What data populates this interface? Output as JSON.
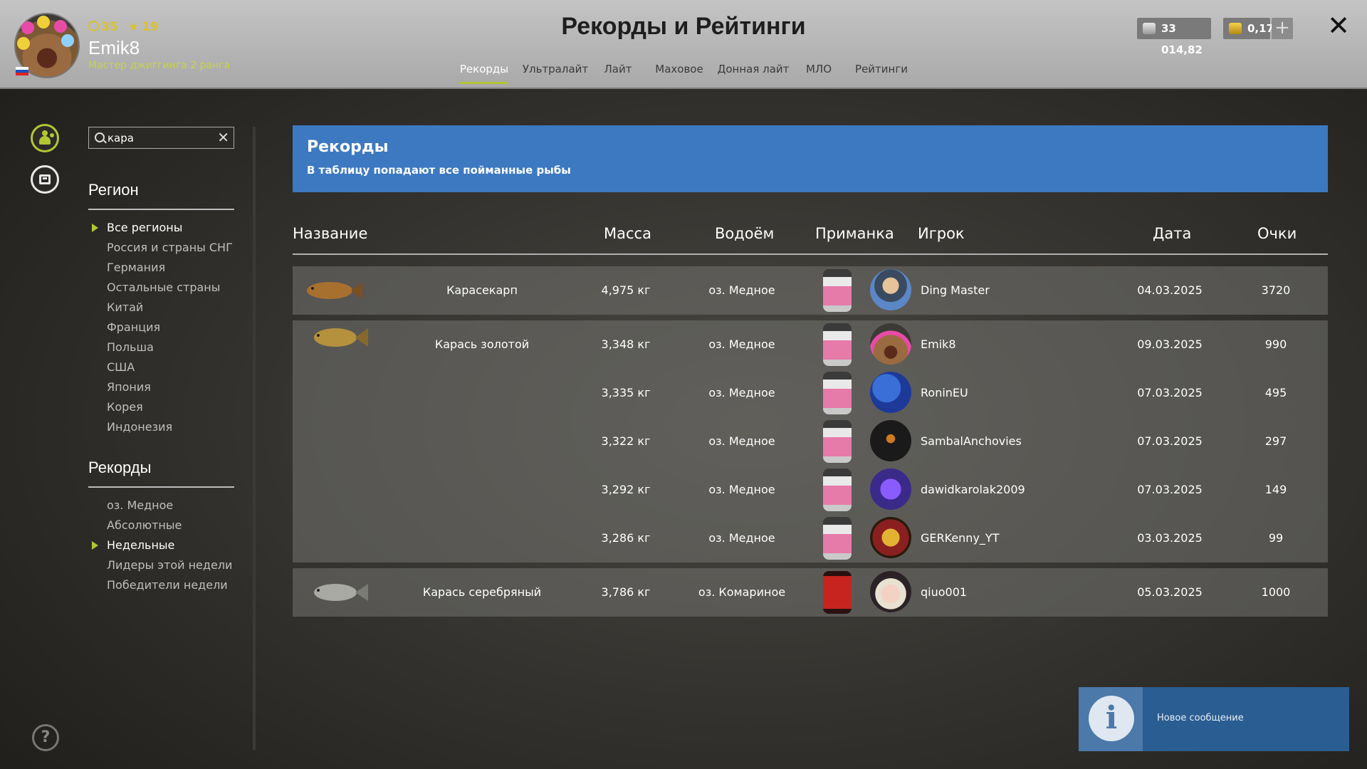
{
  "player": {
    "level": "35",
    "stars": "19",
    "name": "Emik8",
    "title": "Мастер джиггинга 2 ранга"
  },
  "header": {
    "title": "Рекорды и Рейтинги",
    "tabs": [
      "Рекорды",
      "Ультралайт",
      "Лайт",
      "Маховое",
      "Донная лайт",
      "МЛО",
      "Рейтинги"
    ],
    "active_tab": "Рекорды",
    "silver": "33 014,82",
    "gold": "0,17",
    "plus": "+",
    "close": "✕"
  },
  "search": {
    "value": "кара"
  },
  "sidebar": {
    "region_heading": "Регион",
    "regions": [
      "Все регионы",
      "Россия и страны СНГ",
      "Германия",
      "Остальные страны",
      "Китай",
      "Франция",
      "Польша",
      "США",
      "Япония",
      "Корея",
      "Индонезия"
    ],
    "active_region": "Все регионы",
    "records_heading": "Рекорды",
    "records": [
      "оз. Медное",
      "Абсолютные",
      "Недельные",
      "Лидеры этой недели",
      "Победители недели"
    ],
    "active_record": "Недельные"
  },
  "banner": {
    "title": "Рекорды",
    "subtitle": "В таблицу попадают все пойманные рыбы"
  },
  "table": {
    "columns": [
      "Название",
      "Масса",
      "Водоём",
      "Приманка",
      "Игрок",
      "Дата",
      "Очки"
    ],
    "groups": [
      {
        "fish": "Карасекарп",
        "rows": [
          {
            "mass": "4,975 кг",
            "water": "оз. Медное",
            "lure": "pink",
            "player": "Ding Master",
            "date": "04.03.2025",
            "points": "3720"
          }
        ]
      },
      {
        "fish": "Карась золотой",
        "rows": [
          {
            "mass": "3,348 кг",
            "water": "оз. Медное",
            "lure": "pink",
            "player": "Emik8",
            "date": "09.03.2025",
            "points": "990"
          },
          {
            "mass": "3,335 кг",
            "water": "оз. Медное",
            "lure": "pink",
            "player": "RoninEU",
            "date": "07.03.2025",
            "points": "495"
          },
          {
            "mass": "3,322 кг",
            "water": "оз. Медное",
            "lure": "pink",
            "player": "SambalAnchovies",
            "date": "07.03.2025",
            "points": "297"
          },
          {
            "mass": "3,292 кг",
            "water": "оз. Медное",
            "lure": "pink",
            "player": "dawidkarolak2009",
            "date": "07.03.2025",
            "points": "149"
          },
          {
            "mass": "3,286 кг",
            "water": "оз. Медное",
            "lure": "pink",
            "player": "GERKenny_YT",
            "date": "03.03.2025",
            "points": "99"
          }
        ]
      },
      {
        "fish": "Карась серебряный",
        "rows": [
          {
            "mass": "3,786 кг",
            "water": "оз. Комариное",
            "lure": "red",
            "player": "qiuo001",
            "date": "05.03.2025",
            "points": "1000"
          }
        ]
      }
    ]
  },
  "toast": {
    "message": "Новое сообщение",
    "icon": "i"
  },
  "colors": {
    "accent": "#b3c634",
    "banner": "#3c79c1",
    "rank_text": "#c8d34a"
  }
}
